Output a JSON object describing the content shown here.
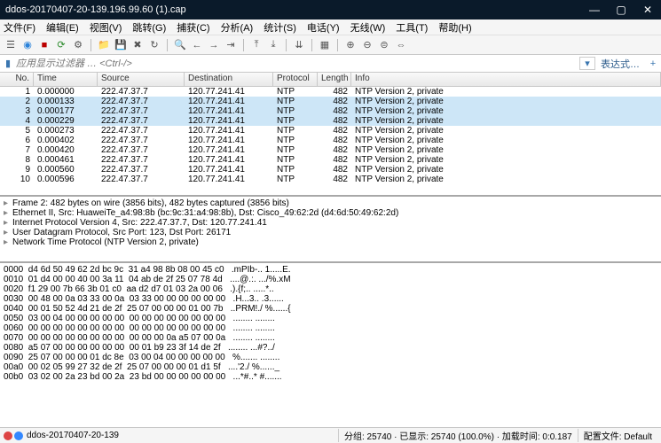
{
  "title": "ddos-20170407-20-139.196.99.60 (1).cap",
  "menu": [
    "文件(F)",
    "编辑(E)",
    "视图(V)",
    "跳转(G)",
    "捕获(C)",
    "分析(A)",
    "统计(S)",
    "电话(Y)",
    "无线(W)",
    "工具(T)",
    "帮助(H)"
  ],
  "filter_placeholder": "应用显示过滤器 … <Ctrl-/>",
  "expr_label": "表达式…",
  "cols": {
    "no": "No.",
    "time": "Time",
    "src": "Source",
    "dst": "Destination",
    "pro": "Protocol",
    "len": "Length",
    "info": "Info"
  },
  "packets": [
    {
      "no": "1",
      "time": "0.000000",
      "src": "222.47.37.7",
      "dst": "120.77.241.41",
      "pro": "NTP",
      "len": "482",
      "info": "NTP Version 2, private",
      "sel": false
    },
    {
      "no": "2",
      "time": "0.000133",
      "src": "222.47.37.7",
      "dst": "120.77.241.41",
      "pro": "NTP",
      "len": "482",
      "info": "NTP Version 2, private",
      "sel": true
    },
    {
      "no": "3",
      "time": "0.000177",
      "src": "222.47.37.7",
      "dst": "120.77.241.41",
      "pro": "NTP",
      "len": "482",
      "info": "NTP Version 2, private",
      "sel": true
    },
    {
      "no": "4",
      "time": "0.000229",
      "src": "222.47.37.7",
      "dst": "120.77.241.41",
      "pro": "NTP",
      "len": "482",
      "info": "NTP Version 2, private",
      "sel": true
    },
    {
      "no": "5",
      "time": "0.000273",
      "src": "222.47.37.7",
      "dst": "120.77.241.41",
      "pro": "NTP",
      "len": "482",
      "info": "NTP Version 2, private",
      "sel": false
    },
    {
      "no": "6",
      "time": "0.000402",
      "src": "222.47.37.7",
      "dst": "120.77.241.41",
      "pro": "NTP",
      "len": "482",
      "info": "NTP Version 2, private",
      "sel": false
    },
    {
      "no": "7",
      "time": "0.000420",
      "src": "222.47.37.7",
      "dst": "120.77.241.41",
      "pro": "NTP",
      "len": "482",
      "info": "NTP Version 2, private",
      "sel": false
    },
    {
      "no": "8",
      "time": "0.000461",
      "src": "222.47.37.7",
      "dst": "120.77.241.41",
      "pro": "NTP",
      "len": "482",
      "info": "NTP Version 2, private",
      "sel": false
    },
    {
      "no": "9",
      "time": "0.000560",
      "src": "222.47.37.7",
      "dst": "120.77.241.41",
      "pro": "NTP",
      "len": "482",
      "info": "NTP Version 2, private",
      "sel": false
    },
    {
      "no": "10",
      "time": "0.000596",
      "src": "222.47.37.7",
      "dst": "120.77.241.41",
      "pro": "NTP",
      "len": "482",
      "info": "NTP Version 2, private",
      "sel": false
    }
  ],
  "detail": [
    "Frame 2: 482 bytes on wire (3856 bits), 482 bytes captured (3856 bits)",
    "Ethernet II, Src: HuaweiTe_a4:98:8b (bc:9c:31:a4:98:8b), Dst: Cisco_49:62:2d (d4:6d:50:49:62:2d)",
    "Internet Protocol Version 4, Src: 222.47.37.7, Dst: 120.77.241.41",
    "User Datagram Protocol, Src Port: 123, Dst Port: 26171",
    "Network Time Protocol (NTP Version 2, private)"
  ],
  "hex": [
    {
      "off": "0000",
      "b": "d4 6d 50 49 62 2d bc 9c  31 a4 98 8b 08 00 45 c0",
      "a": ".mPIb-.. 1.....E."
    },
    {
      "off": "0010",
      "b": "01 d4 00 00 40 00 3a 11  04 ab de 2f 25 07 78 4d",
      "a": "....@.:. .../%.xM"
    },
    {
      "off": "0020",
      "b": "f1 29 00 7b 66 3b 01 c0  aa d2 d7 01 03 2a 00 06",
      "a": ".).{f;.. .....*.."
    },
    {
      "off": "0030",
      "b": "00 48 00 0a 03 33 00 0a  03 33 00 00 00 00 00 00",
      "a": ".H...3.. .3......"
    },
    {
      "off": "0040",
      "b": "00 01 50 52 4d 21 de 2f  25 07 00 00 00 01 00 7b",
      "a": "..PRM!./ %......{"
    },
    {
      "off": "0050",
      "b": "03 00 04 00 00 00 00 00  00 00 00 00 00 00 00 00",
      "a": "........ ........"
    },
    {
      "off": "0060",
      "b": "00 00 00 00 00 00 00 00  00 00 00 00 00 00 00 00",
      "a": "........ ........"
    },
    {
      "off": "0070",
      "b": "00 00 00 00 00 00 00 00  00 00 00 0a a5 07 00 0a",
      "a": "........ ........"
    },
    {
      "off": "0080",
      "b": "a5 07 00 00 00 00 00 00  00 01 b9 23 3f 14 de 2f",
      "a": "........ ...#?../"
    },
    {
      "off": "0090",
      "b": "25 07 00 00 00 01 dc 8e  03 00 04 00 00 00 00 00",
      "a": "%....... ........"
    },
    {
      "off": "00a0",
      "b": "00 02 05 99 27 32 de 2f  25 07 00 00 00 01 d1 5f",
      "a": "....'2./ %......_"
    },
    {
      "off": "00b0",
      "b": "03 02 00 2a 23 bd 00 2a  23 bd 00 00 00 00 00 00",
      "a": "...*#..* #......."
    }
  ],
  "status": {
    "file": "ddos-20170407-20-139",
    "pkts": "分组: 25740 · 已显示: 25740 (100.0%) · 加载时间: 0:0.187",
    "profile": "配置文件: Default"
  }
}
